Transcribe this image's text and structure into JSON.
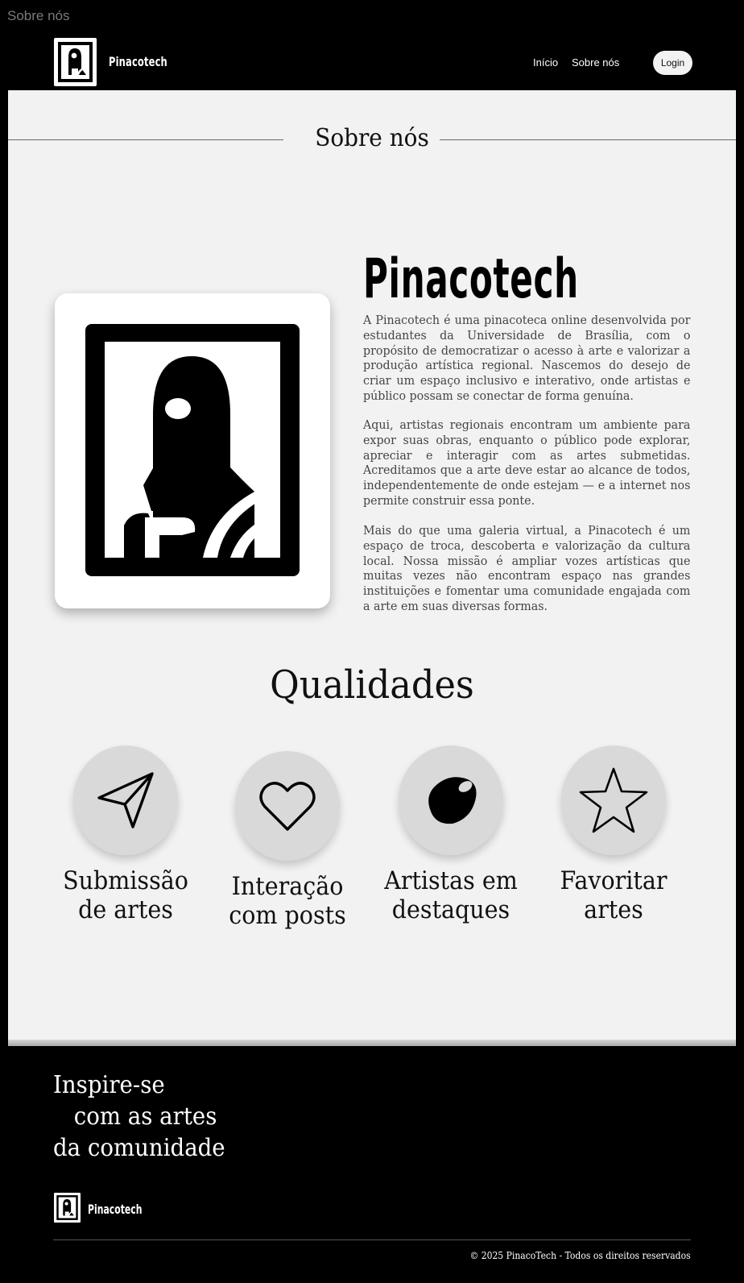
{
  "frame_label": "Sobre nós",
  "header": {
    "logo_icon": "framed-portrait-icon",
    "brand": "Pinacotech",
    "nav": [
      {
        "label": "Início"
      },
      {
        "label": "Sobre nós"
      }
    ],
    "login_label": "Login"
  },
  "main": {
    "section_title": "Sobre nós",
    "image_icon": "framed-portrait-icon",
    "heading": "Pinacotech",
    "paragraphs": [
      "A Pinacotech é uma pinacoteca online desenvolvida por estudantes da Universidade de Brasília, com o propósito de democratizar o acesso à arte e valorizar a produção artística regional. Nascemos do desejo de criar um espaço inclusivo e interativo, onde artistas e público possam se conectar de forma genuína.",
      "Aqui, artistas regionais encontram um ambiente para expor suas obras, enquanto o público pode explorar, apreciar e interagir com as artes submetidas. Acreditamos que a arte deve estar ao alcance de todos, independentemente de onde estejam — e a internet nos permite construir essa ponte.",
      "Mais do que uma galeria virtual, a Pinacotech é um espaço de troca, descoberta e valorização da cultura local. Nossa missão é ampliar vozes artísticas que muitas vezes não encontram espaço nas grandes instituições e fomentar uma comunidade engajada com a arte em suas diversas formas."
    ],
    "qualities_title": "Qualidades",
    "qualities": [
      {
        "icon": "paper-plane-icon",
        "label": "Submissão\nde artes"
      },
      {
        "icon": "heart-icon",
        "label": "Interação\ncom posts"
      },
      {
        "icon": "blob-icon",
        "label": "Artistas em\ndestaques"
      },
      {
        "icon": "star-icon",
        "label": "Favoritar\nartes"
      }
    ]
  },
  "footer": {
    "tagline": [
      "Inspire-se",
      "com as artes",
      "da comunidade"
    ],
    "brand": "Pinacotech",
    "copyright": "© 2025 PinacoTech - Todos os direitos reservados"
  },
  "colors": {
    "page_background": "#000000",
    "content_background": "#f2f2f2",
    "circle_background": "#d9d9d9",
    "text_dark": "#111111",
    "text_body": "#444444"
  }
}
